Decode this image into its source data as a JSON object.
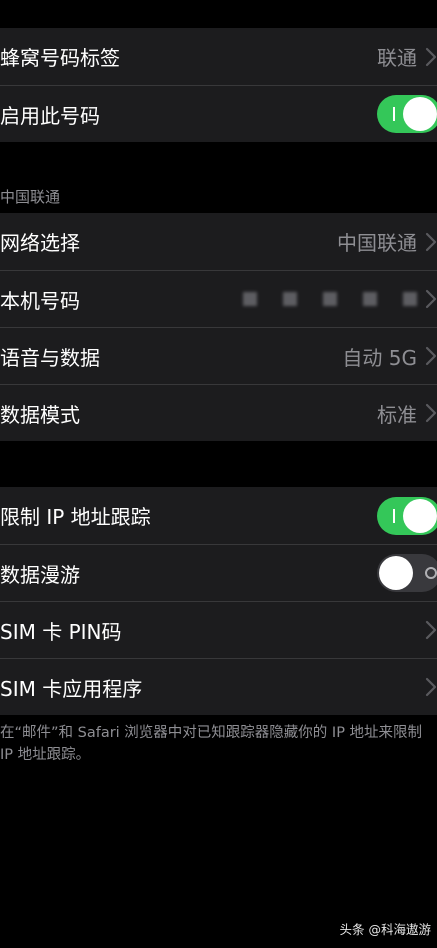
{
  "top_group": {
    "items": [
      {
        "label": "蜂窝号码标签",
        "value": "联通"
      },
      {
        "label": "启用此号码",
        "toggle": "on"
      }
    ]
  },
  "carrier_section": {
    "header": "中国联通",
    "items": [
      {
        "label": "网络选择",
        "value": "中国联通"
      },
      {
        "label": "本机号码",
        "value": ""
      },
      {
        "label": "语音与数据",
        "value": "自动 5G"
      },
      {
        "label": "数据模式",
        "value": "标准"
      }
    ]
  },
  "privacy_group": {
    "items": [
      {
        "label": "限制 IP 地址跟踪",
        "toggle": "on"
      },
      {
        "label": "数据漫游",
        "toggle": "off"
      },
      {
        "label": "SIM 卡 PIN码"
      },
      {
        "label": "SIM 卡应用程序"
      }
    ],
    "footnote": "在“邮件”和 Safari 浏览器中对已知跟踪器隐藏你的 IP 地址来限制 IP 地址跟踪。"
  },
  "watermark": "头条 @科海遨游",
  "colors": {
    "background": "#000000",
    "cell": "#1c1c1e",
    "separator": "#38383a",
    "secondary_text": "#8e8e93",
    "toggle_on": "#34c759",
    "toggle_off": "#39393d"
  },
  "icons": {
    "chevron": "chevron-right-icon"
  }
}
